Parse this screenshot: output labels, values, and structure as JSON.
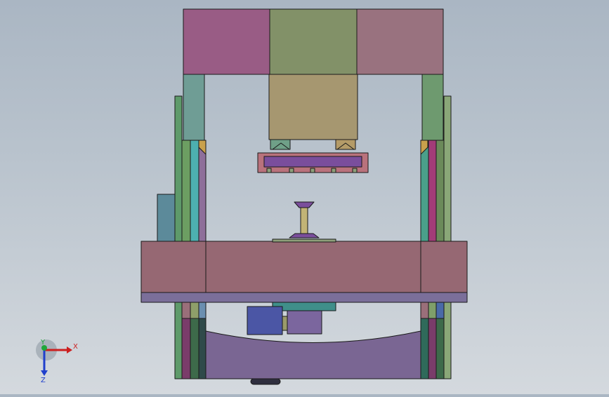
{
  "viewport": {
    "background_top": "#aab6c3",
    "background_bottom": "#d4d9de"
  },
  "model": {
    "parts": [
      {
        "name": "top-beam-left",
        "color": "#995c85"
      },
      {
        "name": "top-beam-center",
        "color": "#829168"
      },
      {
        "name": "top-beam-right",
        "color": "#99727f"
      },
      {
        "name": "hydraulic-cylinder",
        "color": "#a69770"
      },
      {
        "name": "upper-die-plate",
        "color": "#7a4e9c"
      },
      {
        "name": "upper-die-holder",
        "color": "#b9727c"
      },
      {
        "name": "punch-tool",
        "color": "#9c9a7a"
      },
      {
        "name": "worktable",
        "color": "#966873"
      },
      {
        "name": "worktable-base-strip",
        "color": "#7b6f9a"
      },
      {
        "name": "lower-motor-block",
        "color": "#4b56a5"
      },
      {
        "name": "lower-gear-box",
        "color": "#7b669e"
      },
      {
        "name": "base-frame",
        "color": "#7a6693"
      },
      {
        "name": "left-column",
        "color": "#5e9a6a"
      },
      {
        "name": "right-column",
        "color": "#8aa778"
      },
      {
        "name": "side-guard-left",
        "color": "#5c8a9a"
      }
    ]
  },
  "triad": {
    "x_label": "X",
    "y_label": "Y",
    "z_label": "Z",
    "x_color": "#cc1f1f",
    "y_color": "#1fa63a",
    "z_color": "#1f3fcc"
  }
}
